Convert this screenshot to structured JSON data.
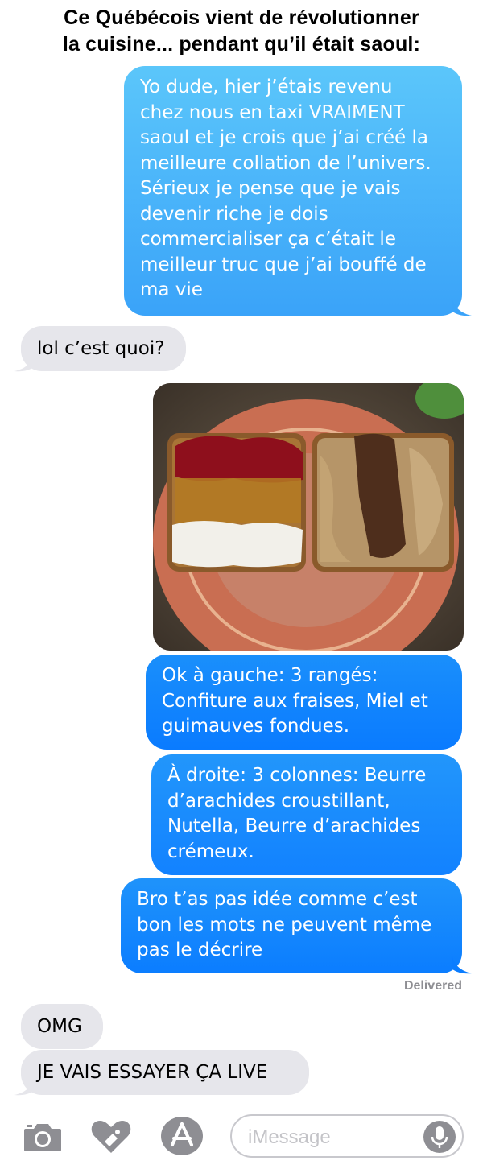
{
  "headline": {
    "line1": "Ce Québécois vient de révolutionner",
    "line2": "la cuisine... pendant qu’il était saoul:"
  },
  "messages": [
    {
      "direction": "sent",
      "lines": [
        "Yo dude, hier j’étais revenu",
        "chez nous en taxi VRAIMENT",
        "saoul et je crois que j’ai créé la",
        "meilleure collation de l’univers.",
        "Sérieux je pense que je vais",
        "devenir riche je dois",
        "commercialiser ça c’était le",
        "meilleur truc que j’ai bouffé de",
        "ma vie"
      ]
    },
    {
      "direction": "received",
      "lines": [
        "lol c’est quoi?"
      ]
    },
    {
      "direction": "sent",
      "type": "photo"
    },
    {
      "direction": "sent",
      "lines": [
        "Ok à gauche: 3 rangés:",
        "Confiture aux fraises, Miel et",
        "guimauves fondues."
      ]
    },
    {
      "direction": "sent",
      "lines": [
        "À droite: 3 colonnes: Beurre",
        "d’arachides croustillant,",
        "Nutella, Beurre d’arachides",
        "crémeux."
      ]
    },
    {
      "direction": "sent",
      "lines": [
        "Bro t’as pas idée comme c’est",
        "bon les mots ne peuvent même",
        "pas le décrire"
      ]
    },
    {
      "direction": "received",
      "lines": [
        "OMG"
      ]
    },
    {
      "direction": "received",
      "lines": [
        "JE VAIS ESSAYER ÇA LIVE"
      ]
    }
  ],
  "status": {
    "delivered": "Delivered"
  },
  "composer": {
    "placeholder": "iMessage",
    "icons": [
      "camera-icon",
      "digital-touch-heart-icon",
      "app-store-icon",
      "microphone-icon"
    ]
  },
  "colors": {
    "sent_top": "#5ac8fa",
    "sent_bottom": "#0a84ff",
    "received": "#e6e6eb",
    "delivered": "#8e8e93",
    "icon_gray": "#8e8e93"
  }
}
